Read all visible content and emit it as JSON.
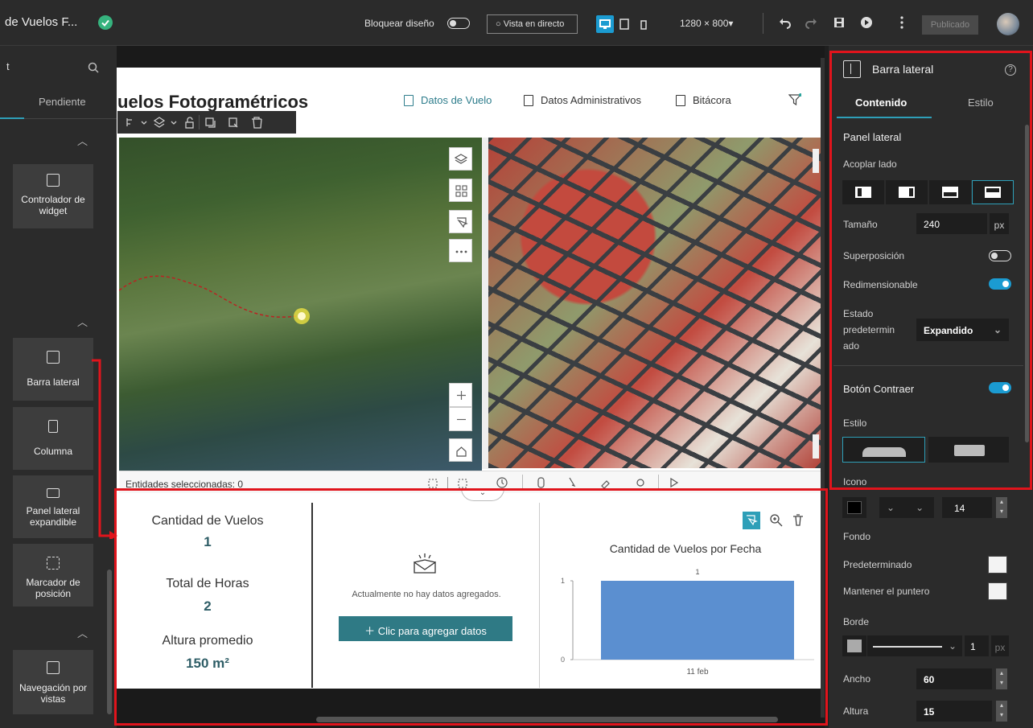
{
  "app": {
    "title": "de Vuelos F...",
    "status": "saved"
  },
  "topbar": {
    "lock_label": "Bloquear diseño",
    "live_view_label": "Vista en directo",
    "resolution": "1280 × 800",
    "published_label": "Publicado"
  },
  "left_panel": {
    "search_prefix": "t",
    "tab_pending": "Pendiente",
    "items": [
      {
        "label1": "Controlador de",
        "label2": "widget"
      },
      {
        "label1": "Barra lateral",
        "label2": ""
      },
      {
        "label1": "Columna",
        "label2": ""
      },
      {
        "label1": "Panel lateral",
        "label2": "expandible"
      },
      {
        "label1": "Marcador de",
        "label2": "posición"
      },
      {
        "label1": "Navegación por",
        "label2": "vistas"
      }
    ]
  },
  "page": {
    "title": "uelos Fotogramétricos",
    "nav": [
      "Datos de Vuelo",
      "Datos Administrativos",
      "Bitácora"
    ],
    "selected_entities": "Entidades seleccionadas: 0",
    "stats": [
      {
        "label": "Cantidad de Vuelos",
        "value": "1"
      },
      {
        "label": "Total de Horas",
        "value": "2"
      },
      {
        "label": "Altura promedio",
        "value": "150 m²"
      }
    ],
    "empty_msg": "Actualmente no hay datos agregados.",
    "add_btn": "Clic para agregar datos"
  },
  "chart_data": {
    "type": "bar",
    "title": "Cantidad de Vuelos por Fecha",
    "categories": [
      "11 feb"
    ],
    "values": [
      1
    ],
    "ylim": [
      0,
      1
    ],
    "yticks": [
      "0",
      "1"
    ],
    "bar_color": "#5b8fd0"
  },
  "right_panel": {
    "title": "Barra lateral",
    "tab_content": "Contenido",
    "tab_style": "Estilo",
    "section": "Panel lateral",
    "dock_label": "Acoplar lado",
    "size_label": "Tamaño",
    "size_value": "240",
    "size_unit": "px",
    "overlay_label": "Superposición",
    "resizable_label": "Redimensionable",
    "default_state_l1": "Estado",
    "default_state_l2": "predetermin",
    "default_state_l3": "ado",
    "default_state_value": "Expandido",
    "collapse_label": "Botón Contraer",
    "style_label": "Estilo",
    "icon_label": "Icono",
    "icon_size": "14",
    "bg_label": "Fondo",
    "default_label": "Predeterminado",
    "hover_label": "Mantener el puntero",
    "border_label": "Borde",
    "border_width": "1",
    "border_unit": "px",
    "width_label": "Ancho",
    "width_value": "60",
    "height_label": "Altura",
    "height_value": "15"
  }
}
